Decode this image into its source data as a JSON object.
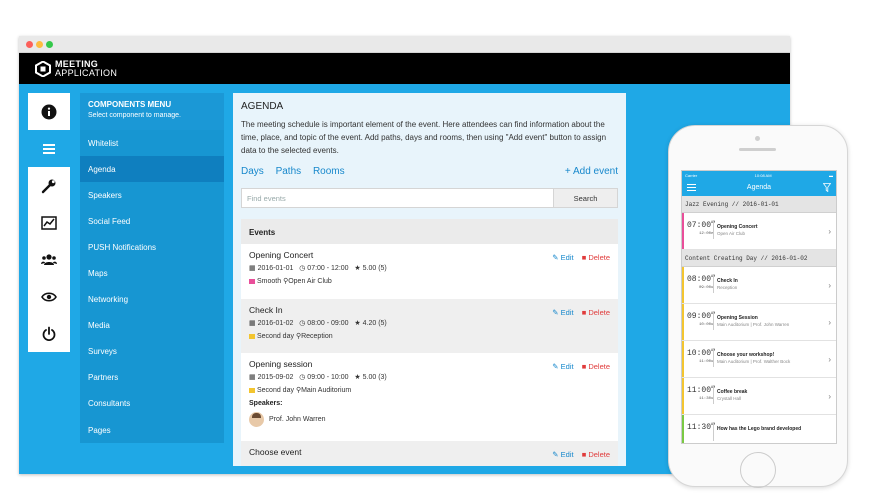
{
  "app": {
    "logo_line1": "MEETING",
    "logo_line2": "APPLICATION"
  },
  "rail": {
    "items": [
      {
        "icon": "info-icon"
      },
      {
        "icon": "list-icon",
        "active": true
      },
      {
        "icon": "wrench-icon"
      },
      {
        "icon": "chart-icon"
      },
      {
        "icon": "users-icon"
      },
      {
        "icon": "eye-icon"
      },
      {
        "icon": "power-icon"
      }
    ]
  },
  "menu": {
    "title": "COMPONENTS MENU",
    "subtitle": "Select component to manage.",
    "items": [
      "Whitelist",
      "Agenda",
      "Speakers",
      "Social Feed",
      "PUSH Notifications",
      "Maps",
      "Networking",
      "Media",
      "Surveys",
      "Partners",
      "Consultants",
      "Pages"
    ],
    "active": "Agenda"
  },
  "agenda": {
    "title": "AGENDA",
    "description": "The meeting schedule is important element of the event. Here attendees can find information about the time, place, and topic of the event. Add paths, days and rooms, then using \"Add event\" button to assign data to the selected events.",
    "tabs": [
      "Days",
      "Paths",
      "Rooms"
    ],
    "add_event": "+ Add event",
    "search_placeholder": "Find events",
    "search_button": "Search",
    "events_header": "Events",
    "edit_label": "Edit",
    "delete_label": "Delete",
    "speakers_label": "Speakers:",
    "events": [
      {
        "title": "Opening Concert",
        "date": "2016-01-01",
        "time": "07:00 - 12:00",
        "rating": "5.00 (5)",
        "path": "Smooth",
        "path_color": "#e94f9a",
        "room": "Open Air Club"
      },
      {
        "title": "Check In",
        "date": "2016-01-02",
        "time": "08:00 - 09:00",
        "rating": "4.20 (5)",
        "path": "Second day",
        "path_color": "#f3c530",
        "room": "Reception"
      },
      {
        "title": "Opening session",
        "date": "2015-09-02",
        "time": "09:00 - 10:00",
        "rating": "5.00 (3)",
        "path": "Second day",
        "path_color": "#f3c530",
        "room": "Main Auditorium",
        "speaker": "Prof. John Warren"
      },
      {
        "title": "Choose event"
      }
    ]
  },
  "phone": {
    "status_left": "Carrier",
    "status_time": "10:08 AM",
    "title": "Agenda",
    "sections": [
      {
        "label": "Jazz Evening  // 2016-01-01",
        "rows": [
          {
            "time": "07:00",
            "ampm": "AM",
            "end": "12:00",
            "end_ampm": "PM",
            "title": "Opening Concert",
            "sub": "Open Air Club",
            "color": "#e94f9a"
          }
        ]
      },
      {
        "label": "Content Creating Day  // 2016-01-02",
        "rows": [
          {
            "time": "08:00",
            "ampm": "AM",
            "end": "09:00",
            "end_ampm": "AM",
            "title": "Check In",
            "sub": "Reception",
            "color": "#f3c530"
          },
          {
            "time": "09:00",
            "ampm": "AM",
            "end": "10:00",
            "end_ampm": "AM",
            "title": "Opening Session",
            "sub": "Main Auditorium  |  Prof. John Warren",
            "color": "#f3c530"
          },
          {
            "time": "10:00",
            "ampm": "AM",
            "end": "11:00",
            "end_ampm": "AM",
            "title": "Choose your workshop!",
            "sub": "Main Auditorium  |  Prof. Walther Bock",
            "color": "#f3c530"
          },
          {
            "time": "11:00",
            "ampm": "AM",
            "end": "11:30",
            "end_ampm": "AM",
            "title": "Coffee break",
            "sub": "Crystall Hall",
            "color": "#f3c530"
          },
          {
            "time": "11:30",
            "ampm": "AM",
            "end": "",
            "end_ampm": "",
            "title": "How has the Lego brand developed",
            "sub": "",
            "color": "#7ac943"
          }
        ]
      }
    ]
  }
}
